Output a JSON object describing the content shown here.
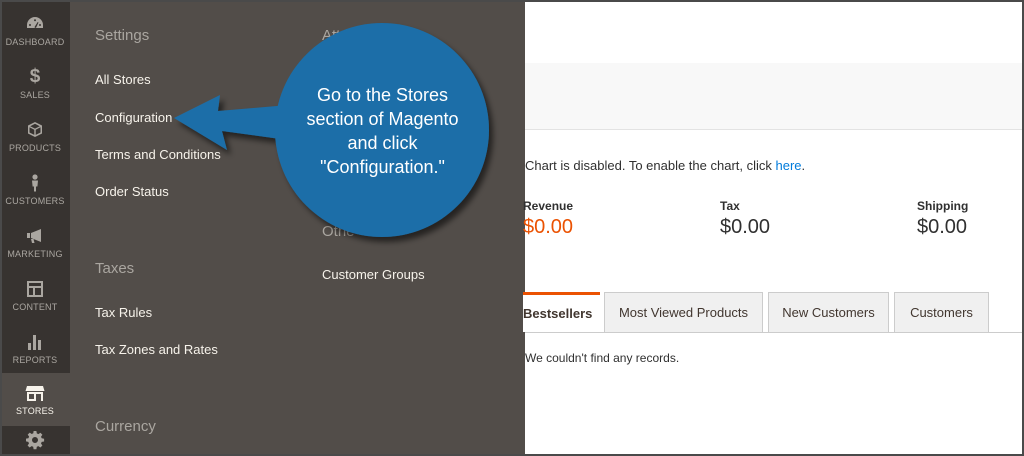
{
  "nav": {
    "items": [
      {
        "label": "DASHBOARD",
        "icon": "dashboard-icon"
      },
      {
        "label": "SALES",
        "icon": "dollar-icon",
        "glyph": "$"
      },
      {
        "label": "PRODUCTS",
        "icon": "cube-icon"
      },
      {
        "label": "CUSTOMERS",
        "icon": "person-icon"
      },
      {
        "label": "MARKETING",
        "icon": "megaphone-icon"
      },
      {
        "label": "CONTENT",
        "icon": "layout-icon"
      },
      {
        "label": "REPORTS",
        "icon": "bar-chart-icon"
      },
      {
        "label": "STORES",
        "icon": "storefront-icon",
        "active": true
      },
      {
        "label": "",
        "icon": "gear-icon"
      }
    ]
  },
  "flyout": {
    "settings": {
      "title": "Settings",
      "items": [
        "All Stores",
        "Configuration",
        "Terms and Conditions",
        "Order Status"
      ]
    },
    "taxes": {
      "title": "Taxes",
      "items": [
        "Tax Rules",
        "Tax Zones and Rates"
      ]
    },
    "currency": {
      "title": "Currency"
    },
    "attributes": {
      "title": "Attri"
    },
    "other": {
      "title": "Othe",
      "items": [
        "Customer Groups"
      ]
    }
  },
  "dashboard": {
    "chart_message": "Chart is disabled. To enable the chart, click ",
    "chart_link": "here",
    "chart_period": ".",
    "metrics": [
      {
        "label": "Revenue",
        "value": "$0.00"
      },
      {
        "label": "Tax",
        "value": "$0.00"
      },
      {
        "label": "Shipping",
        "value": "$0.00"
      }
    ],
    "tabs": [
      "Bestsellers",
      "Most Viewed Products",
      "New Customers",
      "Customers"
    ],
    "empty_message": "We couldn't find any records."
  },
  "callout": {
    "text": "Go to the Stores section of Magento and click \"Configuration.\"",
    "color": "#1b6ea8"
  },
  "colors": {
    "nav_bg": "#373330",
    "flyout_bg": "#524d49",
    "accent": "#eb5202",
    "link": "#007bdb"
  }
}
